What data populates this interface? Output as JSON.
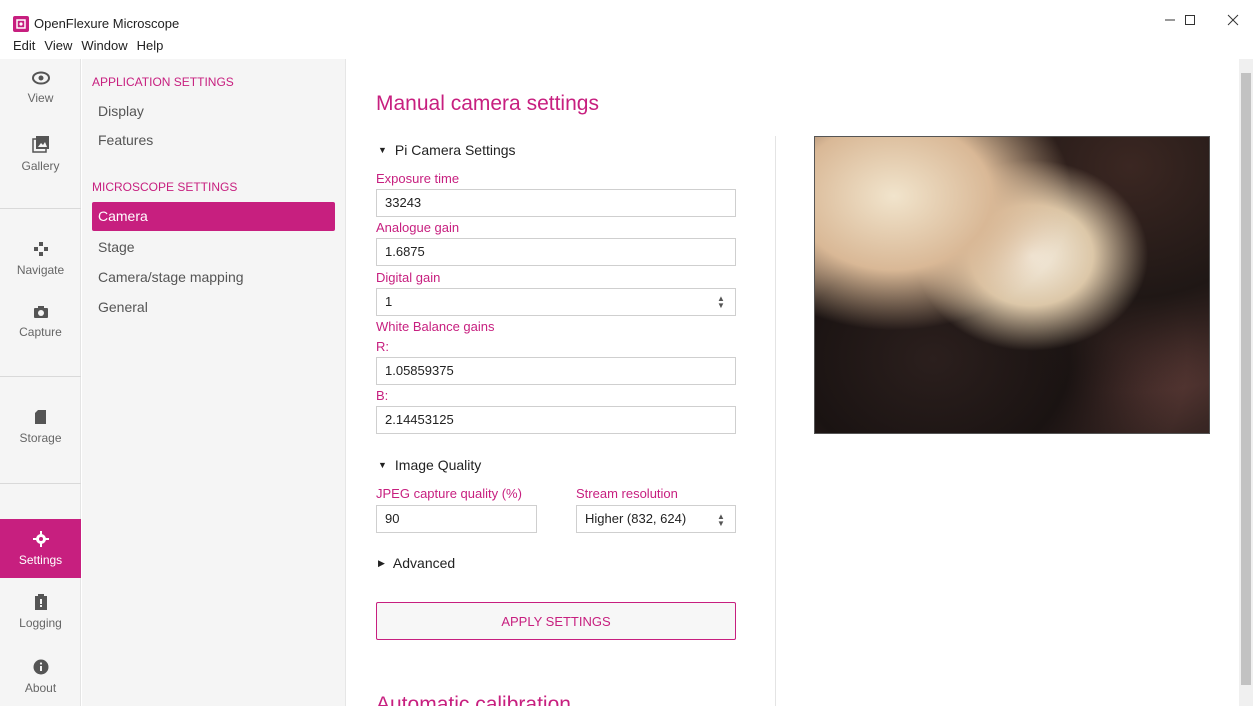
{
  "window": {
    "title": "OpenFlexure Microscope",
    "menu": [
      "Edit",
      "View",
      "Window",
      "Help"
    ]
  },
  "rail": {
    "items": [
      {
        "label": "View",
        "icon": "eye-icon"
      },
      {
        "label": "Gallery",
        "icon": "gallery-icon"
      },
      {
        "label": "Navigate",
        "icon": "navigate-icon"
      },
      {
        "label": "Capture",
        "icon": "camera-icon"
      },
      {
        "label": "Storage",
        "icon": "sd-card-icon"
      },
      {
        "label": "Settings",
        "icon": "gear-icon",
        "active": true
      },
      {
        "label": "Logging",
        "icon": "clipboard-icon"
      },
      {
        "label": "About",
        "icon": "info-icon"
      }
    ]
  },
  "subnav": {
    "app_heading": "APPLICATION SETTINGS",
    "app_items": [
      "Display",
      "Features"
    ],
    "mic_heading": "MICROSCOPE SETTINGS",
    "mic_items": [
      "Camera",
      "Stage",
      "Camera/stage mapping",
      "General"
    ],
    "active": "Camera"
  },
  "main": {
    "title": "Manual camera settings",
    "pi_group": "Pi Camera Settings",
    "exposure": {
      "label": "Exposure time",
      "value": "33243"
    },
    "analogue": {
      "label": "Analogue gain",
      "value": "1.6875"
    },
    "digital": {
      "label": "Digital gain",
      "value": "1"
    },
    "wb": {
      "label": "White Balance gains",
      "r_label": "R:",
      "r_value": "1.05859375",
      "b_label": "B:",
      "b_value": "2.14453125"
    },
    "quality_group": "Image Quality",
    "jpeg": {
      "label": "JPEG capture quality (%)",
      "value": "90"
    },
    "stream": {
      "label": "Stream resolution",
      "value": "Higher (832, 624)"
    },
    "advanced": "Advanced",
    "apply_label": "APPLY SETTINGS",
    "next_section": "Automatic calibration"
  },
  "colors": {
    "accent": "#c71f7f"
  }
}
